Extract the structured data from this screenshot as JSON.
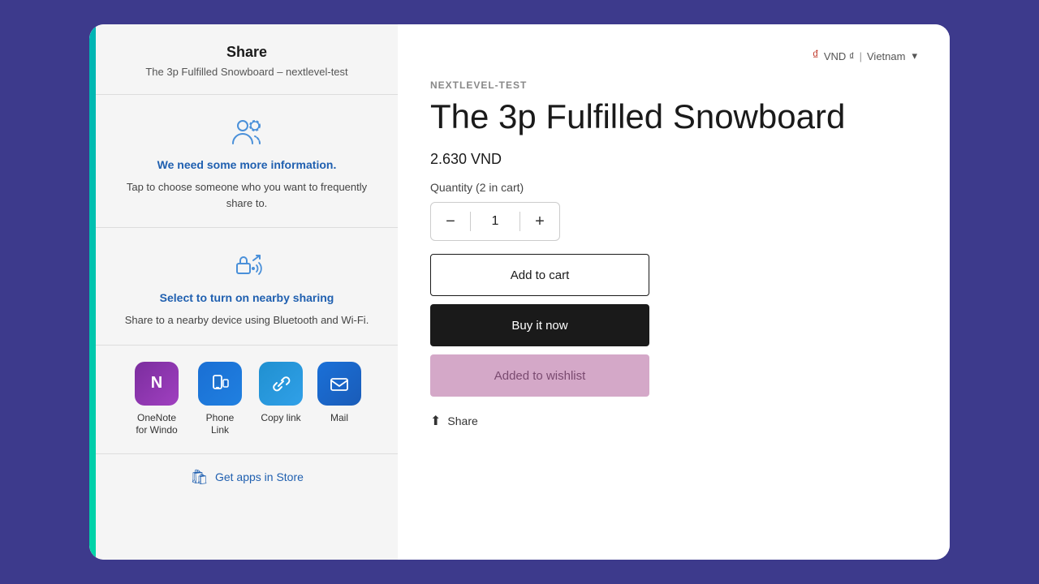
{
  "share": {
    "title": "Share",
    "subtitle": "The 3p Fulfilled Snowboard – nextlevel-test",
    "info_section": {
      "title": "We need some more information.",
      "description": "Tap to choose someone who you want to frequently share to."
    },
    "nearby_section": {
      "title": "Select to turn on nearby sharing",
      "description": "Share to a nearby device using Bluetooth and Wi-Fi."
    },
    "apps": [
      {
        "name": "OneNote for Windo",
        "icon_label": "N"
      },
      {
        "name": "Phone Link",
        "icon_label": "📱"
      },
      {
        "name": "Copy link",
        "icon_label": "🔗"
      },
      {
        "name": "Mail",
        "icon_label": "✉"
      }
    ],
    "store_link": "Get apps in Store"
  },
  "product": {
    "currency": "VND ₫",
    "region": "Vietnam",
    "vendor": "NEXTLEVEL-TEST",
    "title": "The 3p Fulfilled Snowboard",
    "price": "2.630 VND",
    "quantity_label": "Quantity (2 in cart)",
    "quantity_value": "1",
    "btn_add_cart": "Add to cart",
    "btn_buy_now": "Buy it now",
    "btn_wishlist": "Added to wishlist",
    "share_label": "Share"
  }
}
